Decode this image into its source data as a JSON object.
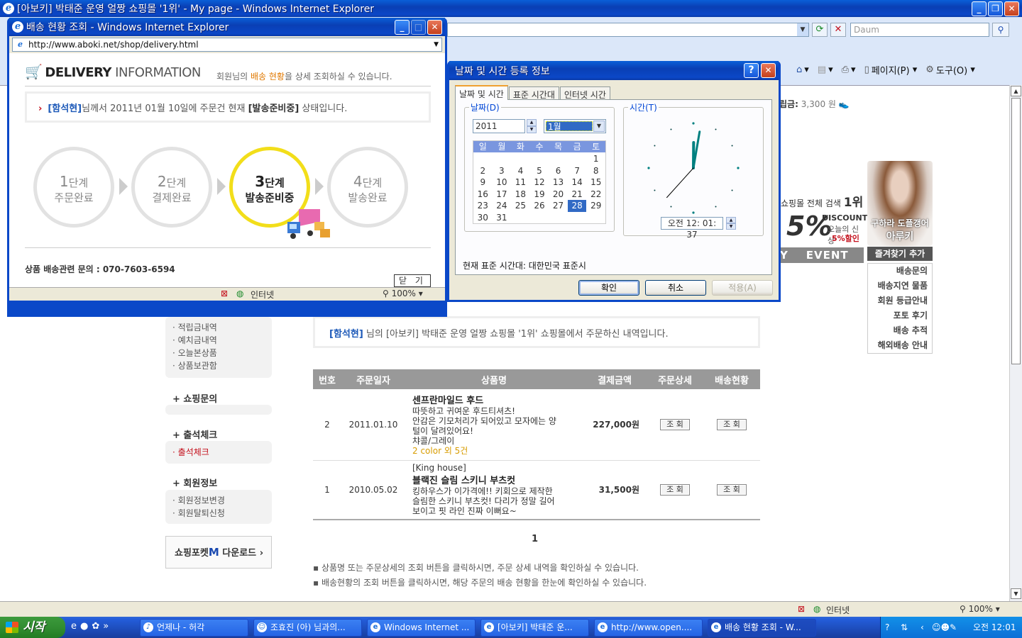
{
  "main_window": {
    "title": "[아보키] 박태준 운영 얼짱 쇼핑몰 '1위' - My page - Windows Internet Explorer",
    "search_placeholder": "Daum",
    "commands": {
      "page": "페이지(P)",
      "tools": "도구(O)"
    },
    "status_zone": "인터넷",
    "zoom": "100%"
  },
  "sidebar": {
    "group1_items": [
      "적립금내역",
      "예치금내역",
      "오늘본상품",
      "상품보관함"
    ],
    "shop_inquiry": "+ 쇼핑문의",
    "attendance": "+ 출석체크",
    "attendance_item": "출석체크",
    "member": "+ 회원정보",
    "member_items": [
      "회원정보변경",
      "회원탈퇴신청"
    ],
    "app_download_a": "쇼핑포켓",
    "app_download_m": "M",
    "app_download_b": " 다운로드"
  },
  "notice": {
    "name": "[함석현]",
    "text": " 님의 [아보키] 박태준 운영 얼짱 쇼핑몰 '1위' 쇼핑몰에서 주문하신 내역입니다."
  },
  "orders": {
    "headers": [
      "번호",
      "주문일자",
      "상품명",
      "결제금액",
      "주문상세",
      "배송현황"
    ],
    "view_label": "조 회",
    "rows": [
      {
        "no": "2",
        "date": "2011.01.10",
        "brand": "",
        "name": "센프란마일드 후드",
        "desc": [
          "따뜻하고 귀여운 후드티셔츠!",
          "안감은 기모처리가 되어있고 모자에는 양",
          "털이 달려있어요!",
          "챠콜/그레이"
        ],
        "color_note": "2 color 외 5건",
        "price": "227,000원"
      },
      {
        "no": "1",
        "date": "2010.05.02",
        "brand": "[King house]",
        "name": "블랙진 슬림 스키니 부츠컷",
        "desc": [
          "킹하우스가 이가격에!! 키회으로 제작한",
          "슬림한 스키니 부츠컷! 다리가 정말 길어",
          "보이고 핏 라인 진짜 이뻐요~"
        ],
        "color_note": "",
        "price": "31,500원"
      }
    ],
    "page": "1",
    "hints": [
      "상품명 또는 주문상세의 조회 버튼을 클릭하시면, 주문 상세 내역을 확인하실 수 있습니다.",
      "배송현황의 조회 버튼을 클릭하시면, 해당 주문의 배송 현황을 한눈에 확인하실 수 있습니다."
    ]
  },
  "right_column": {
    "points_label": "립금:",
    "points_value": "3,300 원",
    "search_rank_label": "쇼핑몰 전체 검색",
    "search_rank_value": "1위",
    "discount_big": "5%",
    "discount_word": "DISCOUNT",
    "discount_sub1": "오늘의 신상",
    "discount_sub2": "5%할인",
    "event_bar_a": "Y",
    "event_bar_b": "EVENT",
    "model_caption1": "구하라 도플갱어",
    "model_caption2": "아루키",
    "fav_button": "즐겨찾기 추가",
    "quick_menu": [
      "배송문의",
      "배송지연 물품",
      "회원 등급안내",
      "포토 후기",
      "배송 추적",
      "해외배송 안내"
    ]
  },
  "delivery_popup": {
    "title": "배송 현황 조회 - Windows Internet Explorer",
    "url": "http://www.aboki.net/shop/delivery.html",
    "logo_bold": "DELIVERY",
    "logo_light": " INFORMATION",
    "subtitle_a": "회원님의 ",
    "subtitle_hl": "배송 현황",
    "subtitle_b": "을 상세 조회하실 수 있습니다.",
    "status_name": "[함석현]",
    "status_mid": "님께서 2011년 01월 10일에 주문건 현재 ",
    "status_state": "[발송준비중]",
    "status_end": " 상태입니다.",
    "stages": [
      {
        "num": "1",
        "unit": "단계",
        "label": "주문완료",
        "active": false
      },
      {
        "num": "2",
        "unit": "단계",
        "label": "결제완료",
        "active": false
      },
      {
        "num": "3",
        "unit": "단계",
        "label": "발송준비중",
        "active": true
      },
      {
        "num": "4",
        "unit": "단계",
        "label": "발송완료",
        "active": false
      }
    ],
    "contact": "상품 배송관련 문의 : 070-7603-6594",
    "close_button": "닫 기",
    "status_zone": "인터넷",
    "zoom": "100%"
  },
  "datetime_dialog": {
    "title": "날짜 및 시간 등록 정보",
    "tabs": [
      "날짜 및 시간",
      "표준 시간대",
      "인터넷 시간"
    ],
    "date_group": "날짜(D)",
    "time_group": "시간(T)",
    "year": "2011",
    "month": "1월",
    "weekdays": [
      "일",
      "월",
      "화",
      "수",
      "목",
      "금",
      "토"
    ],
    "days": [
      "",
      "",
      "",
      "",
      "",
      "",
      "1",
      "2",
      "3",
      "4",
      "5",
      "6",
      "7",
      "8",
      "9",
      "10",
      "11",
      "12",
      "13",
      "14",
      "15",
      "16",
      "17",
      "18",
      "19",
      "20",
      "21",
      "22",
      "23",
      "24",
      "25",
      "26",
      "27",
      "28",
      "29",
      "30",
      "31",
      "",
      "",
      "",
      "",
      ""
    ],
    "selected_day": "28",
    "time": "오전 12: 01: 37",
    "timezone_label": "현재 표준 시간대: 대한민국 표준시",
    "ok": "확인",
    "cancel": "취소",
    "apply": "적용(A)"
  },
  "taskbar": {
    "start": "시작",
    "tasks": [
      "언제나 - 허각",
      "조효진 (아) 님과의...",
      "Windows Internet ...",
      "[아보키] 박태준 운...",
      "http://www.open....",
      "배송 현황 조회 - W..."
    ],
    "clock": "오전 12:01"
  }
}
